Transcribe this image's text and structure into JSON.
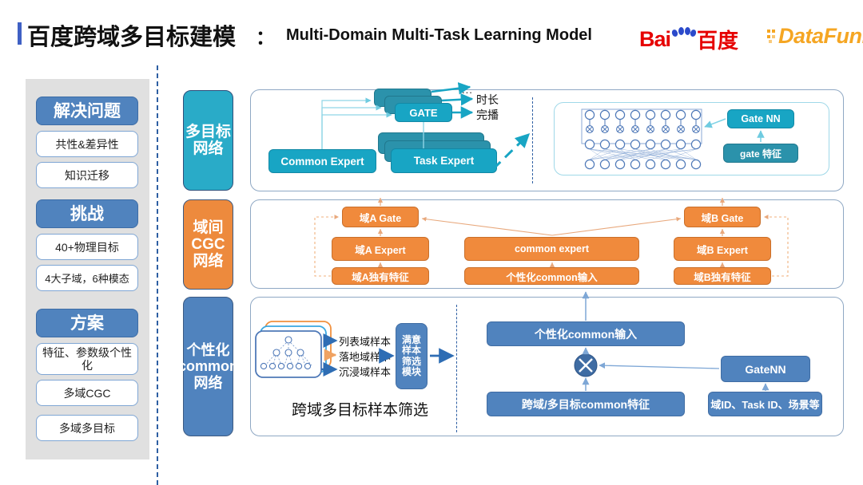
{
  "header": {
    "title_cn": "百度跨域多目标建模",
    "title_colon": "：",
    "title_en": "Multi-Domain Multi-Task Learning Model",
    "baidu_logo": {
      "bai": "Bai",
      "du": "du",
      "cn": "百度"
    },
    "datafun_logo": {
      "text": "DataFun."
    }
  },
  "sidebar": {
    "groups": [
      {
        "head": "解决问题",
        "items": [
          "共性&差异性",
          "知识迁移"
        ]
      },
      {
        "head": "挑战",
        "items": [
          "40+物理目标",
          "4大子域，6种模态"
        ]
      },
      {
        "head": "方案",
        "items": [
          "特征、参数级个性化",
          "多域CGC",
          "多域多目标"
        ]
      }
    ]
  },
  "diagram": {
    "bands": [
      {
        "label": "多目标网络",
        "color": "#29abc8"
      },
      {
        "label": "域间CGC网络",
        "color": "#ed8a3d"
      },
      {
        "label": "个性化common网络",
        "color": "#5083be"
      }
    ],
    "band1": {
      "left": {
        "common_expert": "Common Expert",
        "task_expert": "Task Expert",
        "gate": "GATE",
        "ellipsis": "...",
        "out_labels": [
          "时长",
          "完播"
        ]
      },
      "right": {
        "gate_nn": "Gate NN",
        "gate_feature": "gate 特征"
      }
    },
    "band2": {
      "domain_a_gate": "域A Gate",
      "domain_a_expert": "域A Expert",
      "domain_a_feature": "域A独有特征",
      "common_expert": "common expert",
      "common_input": "个性化common输入",
      "domain_b_gate": "域B Gate",
      "domain_b_expert": "域B Expert",
      "domain_b_feature": "域B独有特征"
    },
    "band3": {
      "sample_labels": [
        "列表域样本",
        "落地域样本",
        "沉浸域样本"
      ],
      "filter_module": "满意样本筛选模块",
      "caption": "跨域多目标样本筛选",
      "common_input": "个性化common输入",
      "common_feature": "跨域/多目标common特征",
      "gate_nn": "GateNN",
      "gate_inputs": "域ID、Task ID、场景等"
    }
  }
}
